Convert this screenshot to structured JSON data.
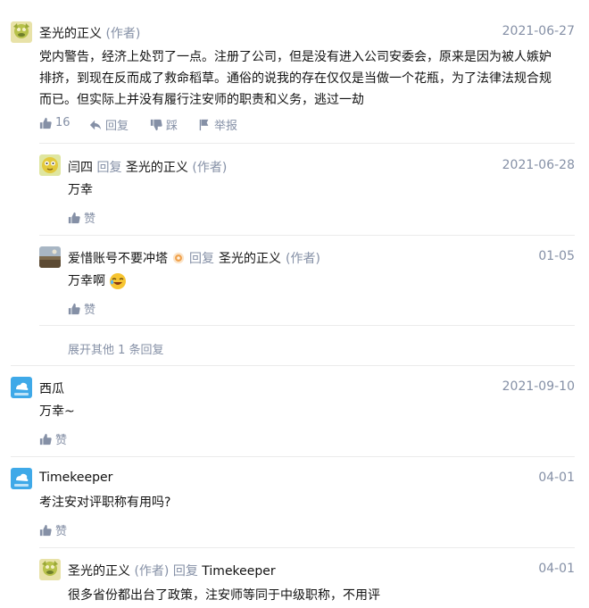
{
  "comments": [
    {
      "author": "圣光的正义",
      "author_tag": "(作者)",
      "date": "2021-06-27",
      "content_lines": [
        "党内警告，经济上处罚了一点。注册了公司，但是没有进入公司安委会，原来是因为被人嫉妒",
        "排挤，到现在反而成了救命稻草。通俗的说我的存在仅仅是当做一个花瓶，为了法律法规合规",
        "而已。但实际上并没有履行注安师的职责和义务，逃过一劫"
      ],
      "likes": "16",
      "reply_label": "回复",
      "dislike_label": "踩",
      "report_label": "举报",
      "replies": [
        {
          "author": "闫四",
          "reply_word": "回复",
          "target": "圣光的正义",
          "target_tag": "(作者)",
          "date": "2021-06-28",
          "content": "万幸",
          "like_label": "赞"
        },
        {
          "author": "爱惜账号不要冲塔",
          "reply_word": "回复",
          "target": "圣光的正义",
          "target_tag": "(作者)",
          "date": "01-05",
          "content": "万幸啊",
          "like_label": "赞"
        }
      ],
      "expand_label": "展开其他 1 条回复"
    },
    {
      "author": "西瓜",
      "date": "2021-09-10",
      "content": "万幸~",
      "like_label": "赞"
    },
    {
      "author": "Timekeeper",
      "date": "04-01",
      "content": "考注安对评职称有用吗?",
      "like_label": "赞",
      "replies": [
        {
          "author": "圣光的正义",
          "author_tag": "(作者)",
          "reply_word": "回复",
          "target": "Timekeeper",
          "date": "04-01",
          "content": "很多省份都出台了政策，注安师等同于中级职称，不用评"
        }
      ]
    }
  ],
  "icons": {
    "like": "thumbs-up-icon",
    "reply": "reply-arrow-icon",
    "dislike": "thumbs-down-icon",
    "report": "flag-icon",
    "badge": "level-badge-icon",
    "emoji": "laughing-emoji-icon"
  },
  "colors": {
    "muted": "#8590a6",
    "text": "#121212",
    "divider": "#ebebeb"
  }
}
